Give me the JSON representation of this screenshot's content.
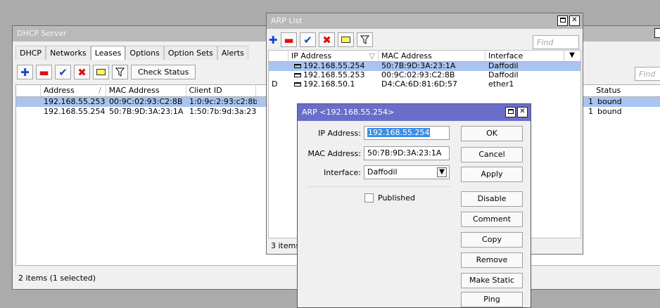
{
  "dhcp": {
    "title": "DHCP Server",
    "tabs": [
      "DHCP",
      "Networks",
      "Leases",
      "Options",
      "Option Sets",
      "Alerts"
    ],
    "check_status": "Check Status",
    "find_placeholder": "Find",
    "columns": [
      "Address",
      "MAC Address",
      "Client ID",
      "Status"
    ],
    "sort_indicator": "/",
    "rows": [
      {
        "address": "192.168.55.253",
        "mac": "00:9C:02:93:C2:8B",
        "client_id": "1:0:9c:2:93:c2:8b",
        "frag": "1",
        "status": "bound"
      },
      {
        "address": "192.168.55.254",
        "mac": "50:7B:9D:3A:23:1A",
        "client_id": "1:50:7b:9d:3a:23:...",
        "frag": "1",
        "status": "bound"
      }
    ],
    "status_text": "2 items (1 selected)"
  },
  "arp": {
    "title": "ARP List",
    "find_placeholder": "Find",
    "columns": [
      "IP Address",
      "MAC Address",
      "Interface"
    ],
    "sort_indicator": "▽",
    "rows": [
      {
        "flag": "",
        "ip": "192.168.55.254",
        "mac": "50:7B:9D:3A:23:1A",
        "iface": "Daffodil"
      },
      {
        "flag": "",
        "ip": "192.168.55.253",
        "mac": "00:9C:02:93:C2:8B",
        "iface": "Daffodil"
      },
      {
        "flag": "D",
        "ip": "192.168.50.1",
        "mac": "D4:CA:6D:81:6D:57",
        "iface": "ether1"
      }
    ],
    "status_text": "3 items"
  },
  "dialog": {
    "title": "ARP <192.168.55.254>",
    "ip_label": "IP Address:",
    "ip_value": "192.168.55.254",
    "mac_label": "MAC Address:",
    "mac_value": "50:7B:9D:3A:23:1A",
    "iface_label": "Interface:",
    "iface_value": "Daffodil",
    "published_label": "Published",
    "buttons": {
      "ok": "OK",
      "cancel": "Cancel",
      "apply": "Apply",
      "disable": "Disable",
      "comment": "Comment",
      "copy": "Copy",
      "remove": "Remove",
      "make_static": "Make Static",
      "ping": "Ping"
    }
  },
  "colors": {
    "active_title": "#6a6ec9",
    "selection": "#a9c4ef",
    "inactive_title": "#b9b9b9"
  }
}
